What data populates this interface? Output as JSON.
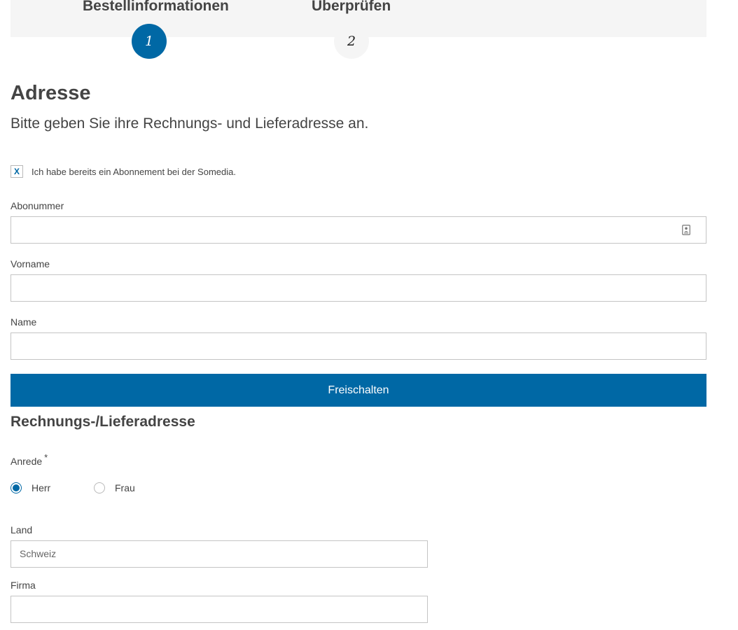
{
  "steps": [
    {
      "label": "Bestellinformationen",
      "number": "1",
      "active": true
    },
    {
      "label": "Überprüfen",
      "number": "2",
      "active": false
    }
  ],
  "address": {
    "title": "Adresse",
    "subtitle": "Bitte geben Sie ihre Rechnungs- und Lieferadresse an."
  },
  "subscription": {
    "checkbox_mark": "X",
    "checkbox_label": "Ich habe bereits ein Abonnement bei der Somedia.",
    "checked": true,
    "fields": {
      "abonummer_label": "Abonummer",
      "abonummer_value": "",
      "vorname_label": "Vorname",
      "vorname_value": "",
      "name_label": "Name",
      "name_value": ""
    },
    "unlock_button": "Freischalten"
  },
  "billing": {
    "title": "Rechnungs-/Lieferadresse",
    "salutation_label": "Anrede",
    "required_mark": "*",
    "salutation_options": [
      {
        "label": "Herr",
        "selected": true
      },
      {
        "label": "Frau",
        "selected": false
      }
    ],
    "country_label": "Land",
    "country_value": "Schweiz",
    "company_label": "Firma",
    "company_value": ""
  },
  "colors": {
    "accent": "#0068a5",
    "stepbar_bg": "#f5f5f5",
    "text": "#444444",
    "border": "#c4c4c4"
  },
  "icons": {
    "abonummer_field": "contact-card-icon"
  }
}
